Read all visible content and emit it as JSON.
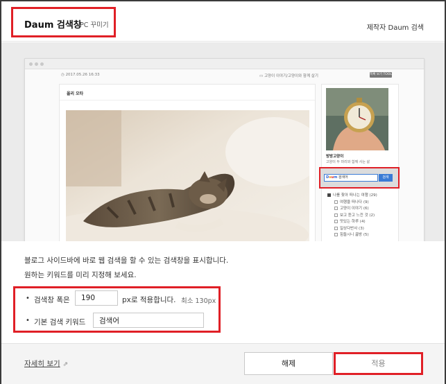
{
  "header": {
    "title": "Daum 검색창",
    "subtitle": "PC 꾸미기",
    "maker": "제작자 Daum 검색"
  },
  "preview": {
    "date": "2017.05.26 16:33",
    "breadcrumb": "고양이 이야기/고양이와 함께 살기",
    "top_button": "목록 보기 TOOL",
    "post_title": "올리 오타",
    "blog_name": "방방고양이",
    "blog_desc": "고양이 두 마리와 함께 사는 삶",
    "search_logo": [
      "D",
      "a",
      "u",
      "m"
    ],
    "search_placeholder": "검색어",
    "search_button": "검색",
    "categories": [
      {
        "label": "나를 찾아 떠나는 여행 (29)",
        "level": 0
      },
      {
        "label": "여행을 떠나다 (9)",
        "level": 1
      },
      {
        "label": "고양이 이야기 (6)",
        "level": 1
      },
      {
        "label": "보고 듣고 느낀 것 (2)",
        "level": 1
      },
      {
        "label": "맛있는 하루 (4)",
        "level": 1
      },
      {
        "label": "일상다반사 (3)",
        "level": 1
      },
      {
        "label": "힘들시니 끓방 (5)",
        "level": 1
      }
    ]
  },
  "description": {
    "line1": "블로그 사이드바에 바로 웹 검색을 할 수 있는 검색창을 표시합니다.",
    "line2": "원하는 키워드를 미리 지정해 보세요."
  },
  "options": {
    "width_label": "검색창 폭은",
    "width_value": "190",
    "width_suffix": "px로 적용합니다.",
    "width_hint": "최소 130px",
    "keyword_label": "기본 검색 키워드",
    "keyword_value": "검색어"
  },
  "footer": {
    "detail_link": "자세히 보기",
    "release_button": "해제",
    "apply_button": "적용"
  },
  "colors": {
    "highlight": "#e01f26",
    "daum_blue": "#3a7bd5"
  }
}
